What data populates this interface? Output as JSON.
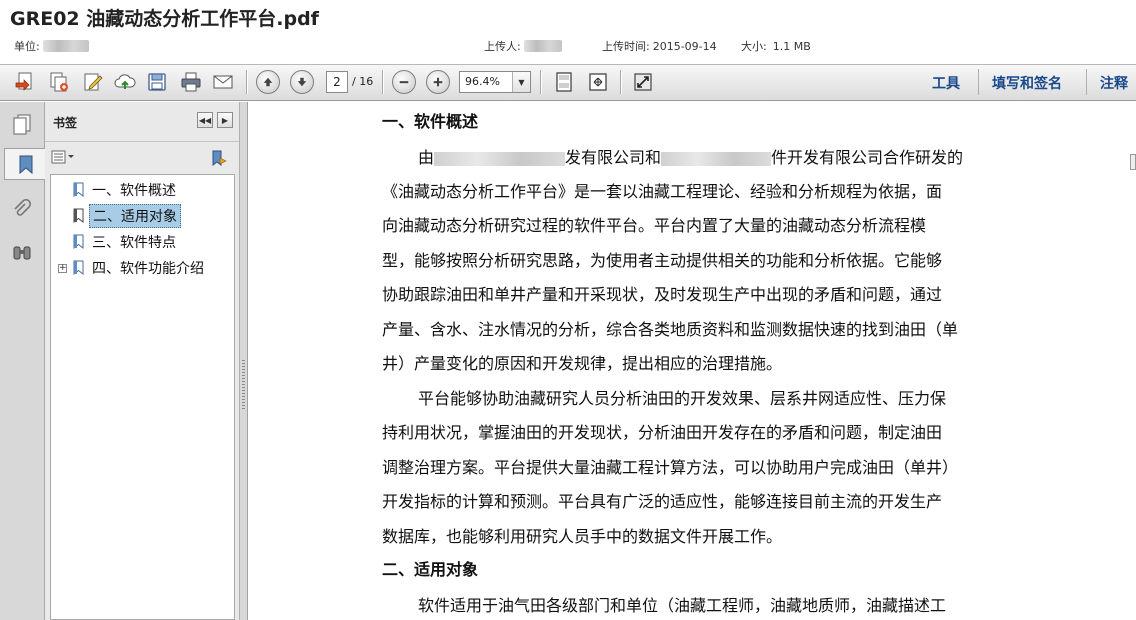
{
  "header": {
    "title": "GRE02 油藏动态分析工作平台.pdf",
    "unit_label": "单位:",
    "uploader_label": "上传人:",
    "upload_time_label": "上传时间:",
    "upload_time": "2015-09-14",
    "size_label": "大小:",
    "size": "1.1 MB"
  },
  "toolbar": {
    "page_current": "2",
    "page_total": "/ 16",
    "zoom": "96.4%",
    "tools_label": "工具",
    "fill_sign_label": "填写和签名",
    "comment_label": "注释"
  },
  "bookmarks": {
    "title": "书签",
    "items": [
      {
        "label": "一、软件概述"
      },
      {
        "label": "二、适用对象"
      },
      {
        "label": "三、软件特点"
      },
      {
        "label": "四、软件功能介绍"
      }
    ]
  },
  "document": {
    "heading1": "一、软件概述",
    "p1_l1_a": "由",
    "p1_l1_b": "发有限公司和",
    "p1_l1_c": "件开发有限公司合作研发的",
    "p1_l2": "《油藏动态分析工作平台》是一套以油藏工程理论、经验和分析规程为依据，面",
    "p1_l3": "向油藏动态分析研究过程的软件平台。平台内置了大量的油藏动态分析流程模",
    "p1_l4": "型，能够按照分析研究思路，为使用者主动提供相关的功能和分析依据。它能够",
    "p1_l5": "协助跟踪油田和单井产量和开采现状，及时发现生产中出现的矛盾和问题，通过",
    "p1_l6": "产量、含水、注水情况的分析，综合各类地质资料和监测数据快速的找到油田（单",
    "p1_l7": "井）产量变化的原因和开发规律，提出相应的治理措施。",
    "p2_l1": "平台能够协助油藏研究人员分析油田的开发效果、层系井网适应性、压力保",
    "p2_l2": "持利用状况，掌握油田的开发现状，分析油田开发存在的矛盾和问题，制定油田",
    "p2_l3": "调整治理方案。平台提供大量油藏工程计算方法，可以协助用户完成油田（单井）",
    "p2_l4": "开发指标的计算和预测。平台具有广泛的适应性，能够连接目前主流的开发生产",
    "p2_l5": "数据库，也能够利用研究人员手中的数据文件开展工作。",
    "heading2": "二、适用对象",
    "p3_l1": "软件适用于油气田各级部门和单位（油藏工程师，油藏地质师，油藏描述工"
  }
}
